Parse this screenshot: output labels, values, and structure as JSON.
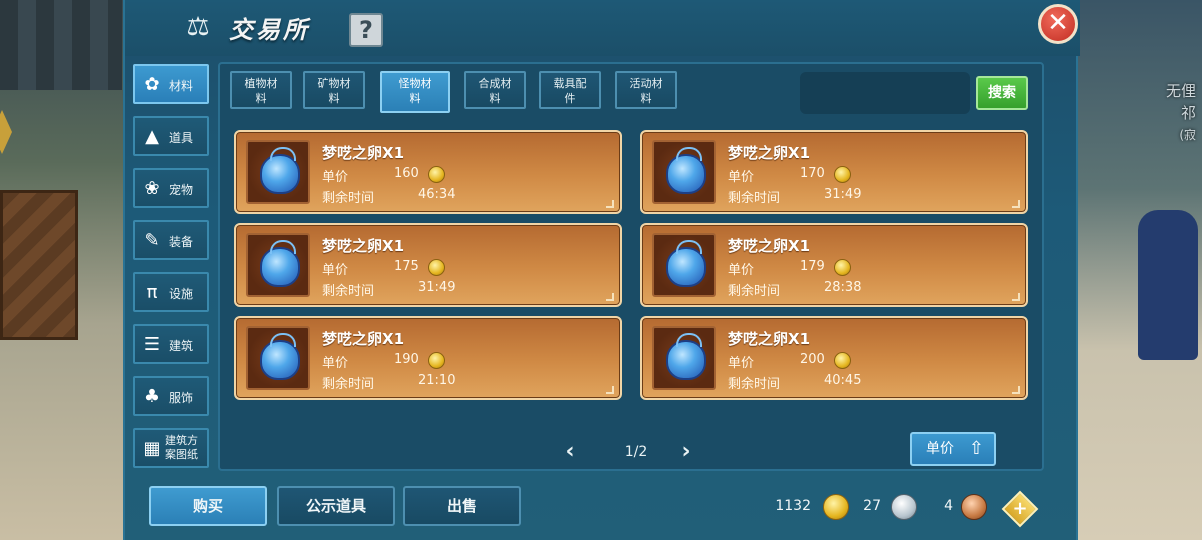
{
  "title": "交易所",
  "help_label": "?",
  "close_label": "✕",
  "background": {
    "npc_name": "无俚",
    "npc_title": "祁",
    "npc_note": "(寂"
  },
  "categories": [
    {
      "label": "材料",
      "icon": "materials-icon",
      "active": true
    },
    {
      "label": "道具",
      "icon": "item-icon",
      "active": false
    },
    {
      "label": "宠物",
      "icon": "pet-paw-icon",
      "active": false
    },
    {
      "label": "装备",
      "icon": "equipment-icon",
      "active": false
    },
    {
      "label": "设施",
      "icon": "facility-icon",
      "active": false
    },
    {
      "label": "建筑",
      "icon": "building-icon",
      "active": false
    },
    {
      "label": "服饰",
      "icon": "clothing-icon",
      "active": false
    },
    {
      "label": "建筑方案图纸",
      "label_line1": "建筑方",
      "label_line2": "案图纸",
      "icon": "blueprint-icon",
      "active": false
    }
  ],
  "subtabs": [
    {
      "line1": "植物材",
      "line2": "料",
      "active": false
    },
    {
      "line1": "矿物材",
      "line2": "料",
      "active": false
    },
    {
      "line1": "怪物材",
      "line2": "料",
      "active": true
    },
    {
      "line1": "合成材",
      "line2": "料",
      "active": false
    },
    {
      "line1": "载具配",
      "line2": "件",
      "active": false
    },
    {
      "line1": "活动材",
      "line2": "料",
      "active": false
    }
  ],
  "search": {
    "value": "",
    "placeholder": "",
    "button_label": "搜索"
  },
  "item_labels": {
    "price": "单价",
    "time_left": "剩余时间"
  },
  "items": [
    {
      "name": "梦呓之卵X1",
      "price": "160",
      "time_left": "46:34"
    },
    {
      "name": "梦呓之卵X1",
      "price": "170",
      "time_left": "31:49"
    },
    {
      "name": "梦呓之卵X1",
      "price": "175",
      "time_left": "31:49"
    },
    {
      "name": "梦呓之卵X1",
      "price": "179",
      "time_left": "28:38"
    },
    {
      "name": "梦呓之卵X1",
      "price": "190",
      "time_left": "21:10"
    },
    {
      "name": "梦呓之卵X1",
      "price": "200",
      "time_left": "40:45"
    }
  ],
  "pagination": {
    "current": "1/2",
    "prev": "‹",
    "next": "›"
  },
  "sort_button": {
    "label": "单价",
    "arrow": "⇧"
  },
  "bottom_buttons": {
    "buy": "购买",
    "public_items": "公示道具",
    "sell": "出售"
  },
  "currency": {
    "gold": "1132",
    "silver": "27",
    "copper": "4",
    "add": "+"
  }
}
